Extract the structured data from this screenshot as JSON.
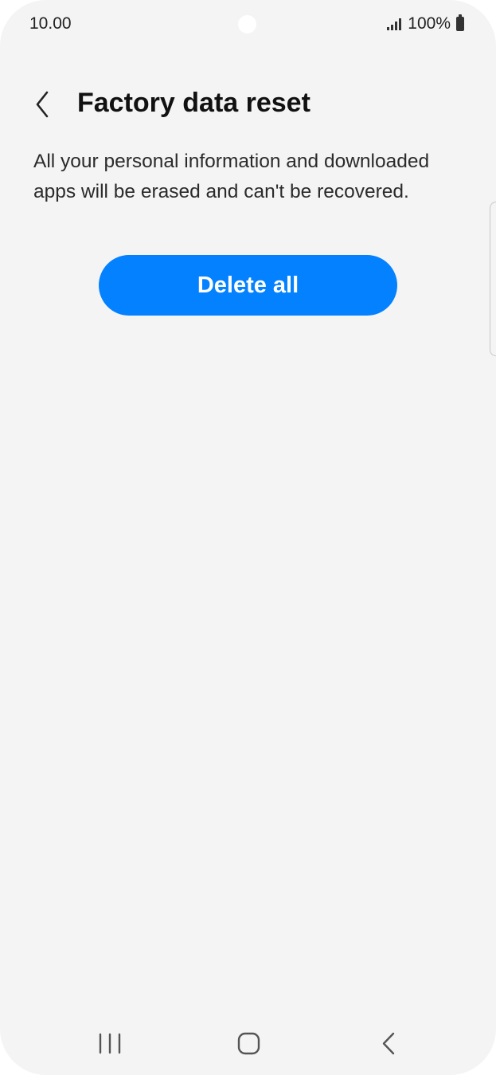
{
  "status_bar": {
    "time": "10.00",
    "battery_percent": "100%",
    "signal_icon": "signal-bars-icon",
    "battery_icon": "battery-icon"
  },
  "header": {
    "back_icon": "chevron-left-icon",
    "title": "Factory data reset"
  },
  "content": {
    "description": "All your personal information and downloaded apps will be erased and can't be recovered.",
    "delete_button_label": "Delete all"
  },
  "nav_bar": {
    "recents_icon": "recents-icon",
    "home_icon": "home-icon",
    "back_icon": "back-icon"
  },
  "colors": {
    "background": "#f4f4f4",
    "accent": "#0381fe",
    "text": "#111111"
  }
}
